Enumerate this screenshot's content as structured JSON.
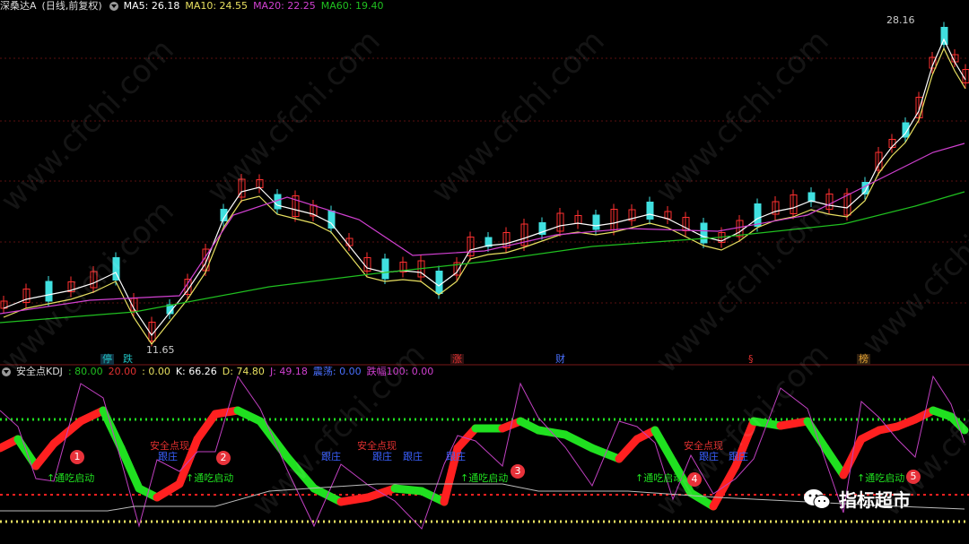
{
  "header": {
    "stock_name": "深桑达A",
    "period": "(日线,前复权)",
    "ma5": "MA5: 26.18",
    "ma10": "MA10: 24.55",
    "ma20": "MA20: 22.25",
    "ma60": "MA60: 19.40"
  },
  "price_labels": {
    "high": "28.16",
    "low": "11.65"
  },
  "events": [
    {
      "label": "停",
      "color": "#20c0c0"
    },
    {
      "label": "跌",
      "color": "#20c0c0"
    },
    {
      "label": "涨",
      "color": "#e03030"
    },
    {
      "label": "财",
      "color": "#4a70ff"
    },
    {
      "label": "§",
      "color": "#e03030"
    },
    {
      "label": "榜",
      "color": "#e0a030"
    }
  ],
  "kdj": {
    "name": "安全点KDJ",
    "v80": ": 80.00",
    "v20": "20.00",
    "v0": ": 0.00",
    "k": "K: 66.26",
    "d": "D: 74.80",
    "j": "J: 49.18",
    "zhendang": "震荡: 0.00",
    "dieFu": "跌幅100: 0.00"
  },
  "annotations": {
    "safe_point": "安全点现",
    "follow": "跟庄",
    "start": "↑通吃启动"
  },
  "badges": [
    "1",
    "2",
    "3",
    "4",
    "5"
  ],
  "watermark": "www.cfchi.com",
  "brand": "指标超市",
  "colors": {
    "up": "#ff3030",
    "down": "#40e0e0",
    "ma5": "#ffffff",
    "ma10": "#e8e060",
    "ma20": "#d040d0",
    "ma60": "#20c020",
    "kdj_up": "#ff2020",
    "kdj_down": "#20e020",
    "j_line": "#c040c0"
  }
}
